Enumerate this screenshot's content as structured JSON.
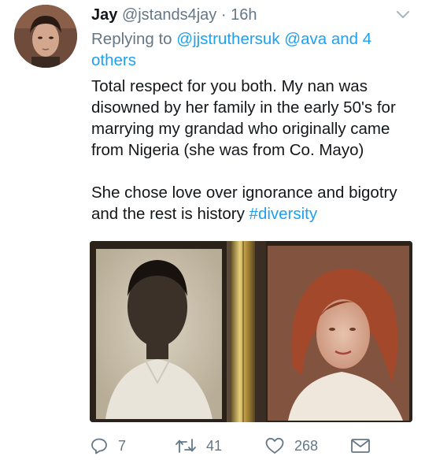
{
  "tweet": {
    "display_name": "Jay",
    "handle": "@jstands4jay",
    "separator": "·",
    "time": "16h",
    "reply_prefix": "Replying to",
    "reply_users": "@jjstruthersuk @ava and 4 others",
    "body_paragraph_1": "Total respect for you both. My nan was disowned by her family in the early 50's for marrying my grandad who originally came from Nigeria (she was from Co. Mayo)",
    "body_paragraph_2_text": "She chose love over ignorance and bigotry and the rest is history ",
    "hashtag": "#diversity"
  },
  "actions": {
    "reply_count": "7",
    "retweet_count": "41",
    "like_count": "268"
  },
  "icons": {
    "reply": "reply-icon",
    "retweet": "retweet-icon",
    "like": "heart-icon",
    "message": "envelope-icon",
    "caret": "chevron-down-icon"
  },
  "colors": {
    "link": "#1da1f2",
    "secondary_text": "#657786",
    "primary_text": "#14171a"
  }
}
